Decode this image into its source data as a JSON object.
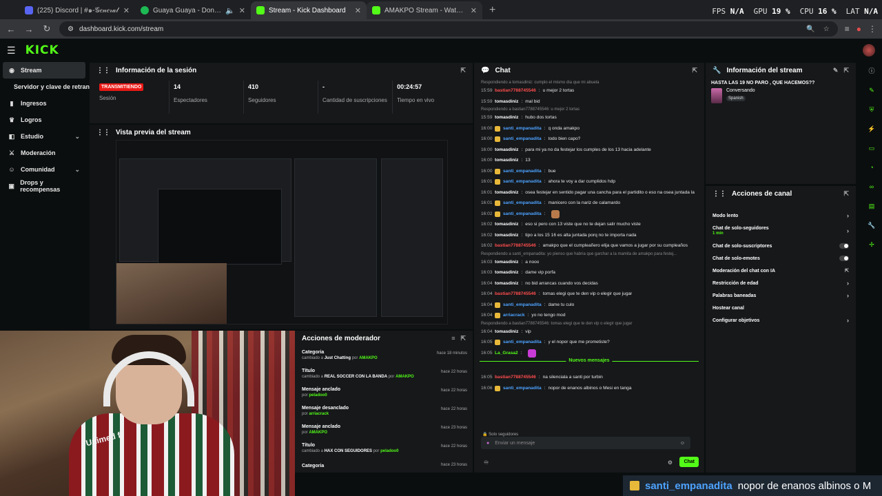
{
  "browser": {
    "tabs": [
      {
        "title": "(225) Discord | #๑-𝒢𝑒𝓃𝑒𝓇𝒶𝓁",
        "favicon_color": "#5865f2"
      },
      {
        "title": "Guaya Guaya - Don Omar",
        "favicon_color": "#1db954"
      },
      {
        "title": "Stream - Kick Dashboard",
        "favicon_color": "#53fc18"
      },
      {
        "title": "AMAKPO Stream - Watch Live o",
        "favicon_color": "#53fc18"
      }
    ],
    "url": "dashboard.kick.com/stream",
    "overlay": {
      "fps_label": "FPS",
      "fps_value": "N/A",
      "gpu_label": "GPU",
      "gpu_value": "19 %",
      "cpu_label": "CPU",
      "cpu_value": "16 %",
      "lat_label": "LAT",
      "lat_value": "N/A"
    }
  },
  "sidebar": {
    "items": [
      {
        "label": "Stream",
        "icon": "broadcast-icon"
      },
      {
        "label": "Servidor y clave de retransn"
      },
      {
        "label": "Ingresos",
        "icon": "money-icon"
      },
      {
        "label": "Logros",
        "icon": "trophy-icon"
      },
      {
        "label": "Estudio",
        "icon": "studio-icon"
      },
      {
        "label": "Moderación",
        "icon": "sword-icon"
      },
      {
        "label": "Comunidad",
        "icon": "users-icon"
      },
      {
        "label": "Drops y recompensas",
        "icon": "gift-icon"
      }
    ]
  },
  "session": {
    "title": "Información de la sesión",
    "live": "TRANSMITIENDO",
    "live_label": "Sesión",
    "stats": [
      {
        "value": "14",
        "label": "Espectadores"
      },
      {
        "value": "410",
        "label": "Seguidores"
      },
      {
        "value": "-",
        "label": "Cantidad de suscripciones"
      },
      {
        "value": "00:24:57",
        "label": "Tiempo en vivo"
      }
    ]
  },
  "preview": {
    "title": "Vista previa del stream"
  },
  "chat": {
    "title": "Chat",
    "messages": [
      {
        "reply": "Respondiendo a tomasdiniz: cumplo el mismo dia que mi abuela"
      },
      {
        "ts": "15:59",
        "user": "bastian7788745546",
        "color": "#ff4d4d",
        "msg": "u mejor 2 tortas"
      },
      {
        "ts": "15:59",
        "user": "tomasdiniz",
        "color": "#ffffff",
        "msg": "mal bid"
      },
      {
        "reply": "Respondiendo a bastian7788745546: u mejor 2 tortas"
      },
      {
        "ts": "15:59",
        "user": "tomasdiniz",
        "color": "#ffffff",
        "msg": "hubo dos tortas"
      },
      {
        "ts": "16:00",
        "user": "santi_empanadita",
        "color": "#4ea3ff",
        "msg": "q onda amakpo"
      },
      {
        "ts": "16:00",
        "user": "santi_empanadita",
        "color": "#4ea3ff",
        "msg": "todo bien capo?"
      },
      {
        "ts": "16:00",
        "user": "tomasdiniz",
        "color": "#ffffff",
        "msg": "para mi ya no da festejar los cumples de los 13 hacia adelante"
      },
      {
        "ts": "16:00",
        "user": "tomasdiniz",
        "color": "#ffffff",
        "msg": "13"
      },
      {
        "ts": "16:00",
        "user": "santi_empanadita",
        "color": "#4ea3ff",
        "msg": "bue"
      },
      {
        "ts": "16:01",
        "user": "santi_empanadita",
        "color": "#4ea3ff",
        "msg": "ahora te voy a dar cumplidos hdp"
      },
      {
        "ts": "16:01",
        "user": "tomasdiniz",
        "color": "#ffffff",
        "msg": "osea festejar en sentido pagar una cancha para el partidito o eso na osea juntada la"
      },
      {
        "ts": "16:01",
        "user": "santi_empanadita",
        "color": "#4ea3ff",
        "msg": "manicero con la nariz de calamardo"
      },
      {
        "ts": "16:02",
        "user": "santi_empanadita",
        "color": "#4ea3ff",
        "msg": ""
      },
      {
        "ts": "16:02",
        "user": "tomasdiniz",
        "color": "#ffffff",
        "msg": "eso si pero con 13 viste que no te dejan salir mucho viste"
      },
      {
        "ts": "16:02",
        "user": "tomasdiniz",
        "color": "#ffffff",
        "msg": "tipo a los 15 16 es alta juntada porq no te importa nada"
      },
      {
        "ts": "16:02",
        "user": "bastian7788745546",
        "color": "#ff4d4d",
        "msg": "amakpo que el cumpleañero elija que vamos a jugar por su cumpleaños"
      },
      {
        "reply": "Respondiendo a santi_empanadita: yo pienso que habria que garchar a la mamita de amakpo para festej..."
      },
      {
        "ts": "16:03",
        "user": "tomasdiniz",
        "color": "#ffffff",
        "msg": "a nooo"
      },
      {
        "ts": "16:03",
        "user": "tomasdiniz",
        "color": "#ffffff",
        "msg": "dame vip porfa"
      },
      {
        "ts": "16:04",
        "user": "tomasdiniz",
        "color": "#ffffff",
        "msg": "no bid arrancas cuando vos decidas"
      },
      {
        "ts": "16:04",
        "user": "bastian7788745546",
        "color": "#ff4d4d",
        "msg": "tomas elegi que te den vip o elegir que jugar"
      },
      {
        "ts": "16:04",
        "user": "santi_empanadita",
        "color": "#4ea3ff",
        "msg": "dame tu culo"
      },
      {
        "ts": "16:04",
        "user": "arriacrack",
        "color": "#4ea3ff",
        "msg": "yo no tengo mod"
      },
      {
        "reply": "Respondiendo a bastian7788745546: tomas elegi que te den vip o elegir que jugar"
      },
      {
        "ts": "16:04",
        "user": "tomasdiniz",
        "color": "#ffffff",
        "msg": "vip"
      },
      {
        "ts": "16:05",
        "user": "santi_empanadita",
        "color": "#4ea3ff",
        "msg": "y el nopor que me prometiste?"
      },
      {
        "ts": "16:05",
        "user": "La_Grasa2",
        "color": "#53fc18",
        "msg": ""
      }
    ],
    "new_messages": "Nuevos mensajes",
    "new": [
      {
        "ts": "16:05",
        "user": "bastian7788745546",
        "color": "#ff4d4d",
        "msg": "na silenciala a santi por turbin"
      },
      {
        "ts": "16:06",
        "user": "santi_empanadita",
        "color": "#4ea3ff",
        "msg": "nopor de enanos albinos o Mesi en tanga"
      }
    ],
    "mode": "Solo seguidores",
    "placeholder": "Enviar un mensaje",
    "send": "Chat"
  },
  "stream_info": {
    "title": "Información del stream",
    "stream_title": "HASTA LAS 19 NO PARO , QUE HACEMOS??",
    "category": "Conversando",
    "language": "Spanish"
  },
  "actions": {
    "title": "Acciones de canal",
    "rows": [
      {
        "label": "Modo lento",
        "control": "chevron"
      },
      {
        "label": "Chat de solo-seguidores",
        "sub": "1 min",
        "control": "chevron"
      },
      {
        "label": "Chat de solo-suscriptores",
        "control": "toggle"
      },
      {
        "label": "Chat de solo-emotes",
        "control": "toggle"
      },
      {
        "label": "Moderación del chat con IA",
        "control": "external"
      },
      {
        "label": "Restricción de edad",
        "control": "chevron"
      },
      {
        "label": "Palabras baneadas",
        "control": "chevron"
      },
      {
        "label": "Hostear canal",
        "control": "none"
      },
      {
        "label": "Configurar objetivos",
        "control": "chevron"
      }
    ]
  },
  "mod_actions": {
    "title": "Acciones de moderador",
    "items": [
      {
        "title": "Categoria",
        "pre": "cambiado a",
        "value": "Just Chatting",
        "by": "por",
        "user": "AMAKPO",
        "time": "hace 18 minutos"
      },
      {
        "title": "Título",
        "pre": "cambiado a",
        "value": "REAL SOCCER CON LA BANDA",
        "by": "por",
        "user": "AMAKPO",
        "time": "hace 22 horas"
      },
      {
        "title": "Mensaje anclado",
        "pre": "",
        "value": "",
        "by": "por",
        "user": "peladoo0",
        "time": "hace 22 horas"
      },
      {
        "title": "Mensaje desanclado",
        "pre": "",
        "value": "",
        "by": "por",
        "user": "arriacrack",
        "time": "hace 22 horas"
      },
      {
        "title": "Mensaje anclado",
        "pre": "",
        "value": "",
        "by": "por",
        "user": "AMAKPO",
        "time": "hace 23 horas"
      },
      {
        "title": "Título",
        "pre": "cambiado a",
        "value": "HAX CON SEGUIDORES",
        "by": "por",
        "user": "peladoo0",
        "time": "hace 22 horas"
      },
      {
        "title": "Categoria",
        "pre": "",
        "value": "",
        "by": "",
        "user": "",
        "time": "hace 23 horas"
      }
    ]
  },
  "webcam": {
    "shirt_text": "Unimed fl"
  },
  "banner": {
    "user": "santi_empanadita",
    "msg": "nopor de enanos albinos o M"
  }
}
